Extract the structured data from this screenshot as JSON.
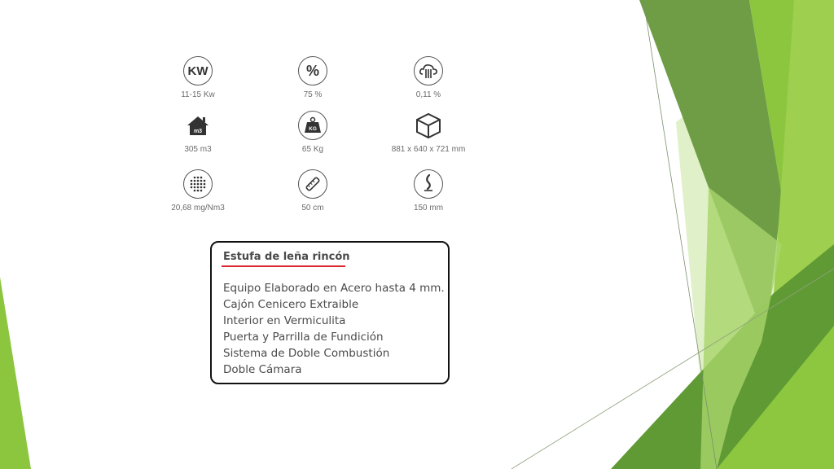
{
  "specs": [
    {
      "icon": "kw-icon",
      "icon_text": "KW",
      "value": "11-15 Kw"
    },
    {
      "icon": "percent-icon",
      "icon_text": "%",
      "value": "75 %"
    },
    {
      "icon": "emission-cloud-icon",
      "icon_text": "",
      "value": "0,11 %"
    },
    {
      "icon": "house-m3-icon",
      "icon_text": "m3",
      "value": "305 m3"
    },
    {
      "icon": "weight-kg-icon",
      "icon_text": "KG",
      "value": "65 Kg"
    },
    {
      "icon": "box-dimensions-icon",
      "icon_text": "",
      "value": "881 x 640 x 721 mm"
    },
    {
      "icon": "particles-icon",
      "icon_text": "",
      "value": "20,68 mg/Nm3"
    },
    {
      "icon": "log-length-icon",
      "icon_text": "",
      "value": "50 cm"
    },
    {
      "icon": "smoke-outlet-icon",
      "icon_text": "",
      "value": "150 mm"
    }
  ],
  "feature_box": {
    "title": "Estufa de leña rincón",
    "items": [
      "Equipo Elaborado en Acero hasta 4 mm.",
      "Cajón Cenicero Extraible",
      "Interior en Vermiculita",
      "Puerta y Parrilla de Fundición",
      "Sistema de Doble Combustión",
      "Doble Cámara"
    ]
  },
  "theme_colors": {
    "accent_red": "#d7262e",
    "green_dark": "#5e8f3a",
    "green_mid": "#8cc63f",
    "green_light": "#c6e39a"
  }
}
